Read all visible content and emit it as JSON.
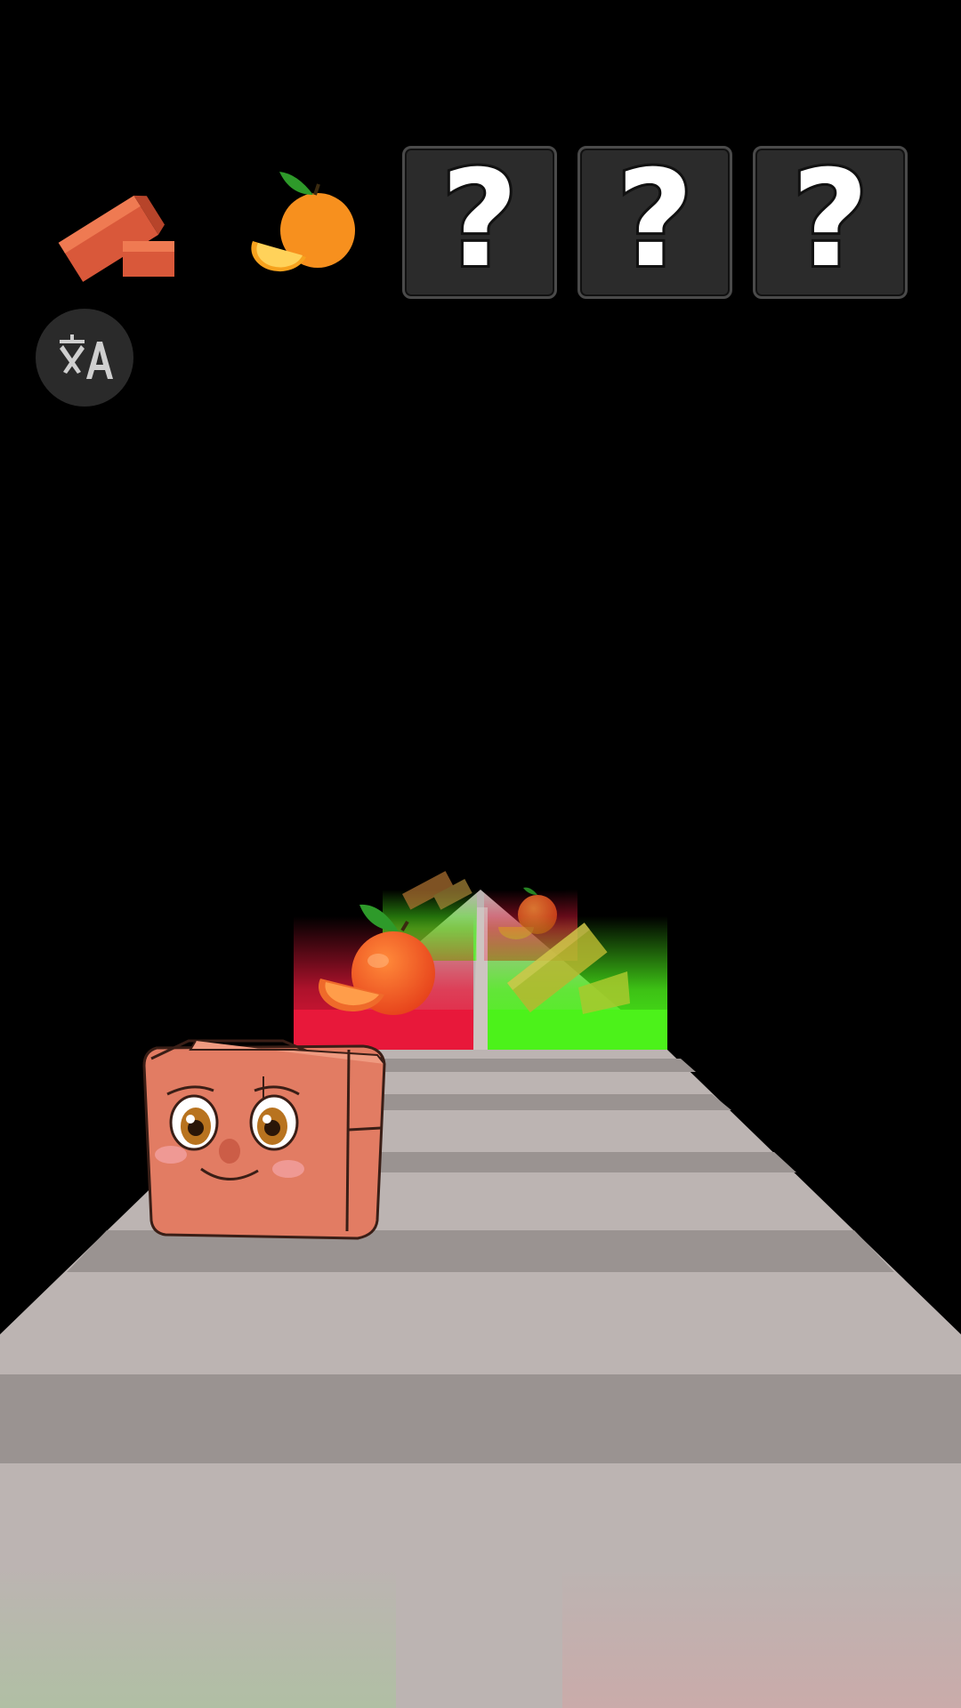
{
  "collection_bar": {
    "slots": [
      {
        "type": "found",
        "icon": "brick-icon"
      },
      {
        "type": "found",
        "icon": "orange-icon"
      },
      {
        "type": "hidden",
        "label": "?"
      },
      {
        "type": "hidden",
        "label": "?"
      },
      {
        "type": "hidden",
        "label": "?"
      }
    ]
  },
  "translate_button": {
    "icon": "translate-icon"
  },
  "gates": [
    {
      "item": "orange",
      "color": "red"
    },
    {
      "item": "brick",
      "color": "green"
    }
  ],
  "far_gates": [
    {
      "item": "brick",
      "color": "green"
    },
    {
      "item": "orange",
      "color": "red"
    }
  ],
  "player": {
    "character": "brick-character"
  },
  "colors": {
    "background": "#000000",
    "red_gate": "#e8183a",
    "green_gate": "#4cf21a",
    "road_light": "#bcb4b2",
    "road_dark": "#9a9391",
    "brick": "#e07a5f"
  }
}
